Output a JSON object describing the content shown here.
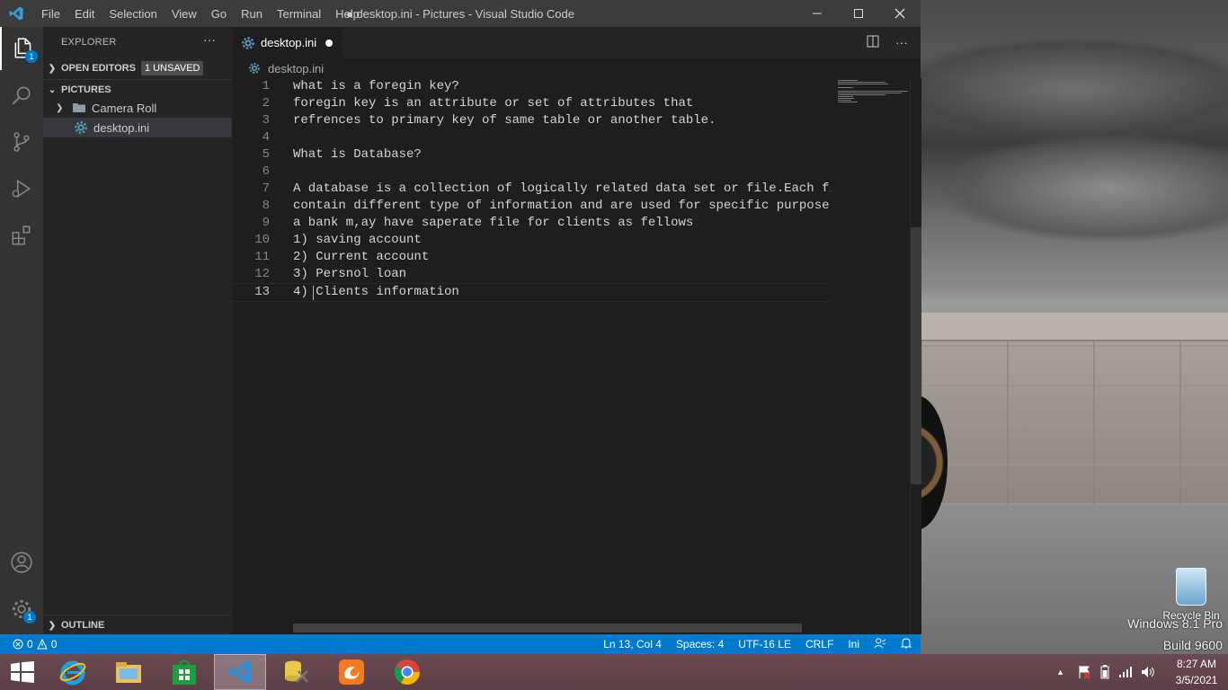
{
  "window": {
    "title": "● desktop.ini - Pictures - Visual Studio Code",
    "menu": [
      "File",
      "Edit",
      "Selection",
      "View",
      "Go",
      "Run",
      "Terminal",
      "Help"
    ]
  },
  "activity": {
    "explorer_badge": "1",
    "settings_badge": "1"
  },
  "sidebar": {
    "title": "EXPLORER",
    "open_editors": {
      "label": "OPEN EDITORS",
      "badge": "1 UNSAVED"
    },
    "folder": {
      "label": "PICTURES"
    },
    "items": [
      {
        "label": "Camera Roll",
        "type": "folder"
      },
      {
        "label": "desktop.ini",
        "type": "file"
      }
    ],
    "outline": "OUTLINE"
  },
  "tab": {
    "label": "desktop.ini"
  },
  "breadcrumb": "desktop.ini",
  "editor": {
    "lines": [
      {
        "n": "1",
        "text": "what is a foregin key?"
      },
      {
        "n": "2",
        "text": "foregin key is an attribute or set of attributes that"
      },
      {
        "n": "3",
        "text": "refrences to primary key of same table or another table."
      },
      {
        "n": "4",
        "text": ""
      },
      {
        "n": "5",
        "text": "What is Database?"
      },
      {
        "n": "6",
        "text": ""
      },
      {
        "n": "7",
        "text": "A database is a collection of logically related data set or file.Each file may"
      },
      {
        "n": "8",
        "text": "contain different type of information and are used for specific purpose"
      },
      {
        "n": "9",
        "text": "a bank m,ay have saperate file for clients as fellows"
      },
      {
        "n": "10",
        "text": "1) saving account"
      },
      {
        "n": "11",
        "text": "2) Current account"
      },
      {
        "n": "12",
        "text": "3) Persnol loan"
      },
      {
        "n": "13",
        "text": "4) Clients information"
      }
    ],
    "current_line": 13
  },
  "status": {
    "errors": "0",
    "warnings": "0",
    "position": "Ln 13, Col 4",
    "spaces": "Spaces: 4",
    "encoding": "UTF-16 LE",
    "eol": "CRLF",
    "language": "Ini"
  },
  "desktop": {
    "recycle_bin": "Recycle Bin",
    "watermark_line1": "Windows 8.1 Pro",
    "watermark_line2": "Build 9600"
  },
  "clock": {
    "time": "8:27 AM",
    "date": "3/5/2021"
  },
  "colors": {
    "accent": "#007acc",
    "editor_bg": "#1e1e1e",
    "sidebar_bg": "#252526"
  }
}
